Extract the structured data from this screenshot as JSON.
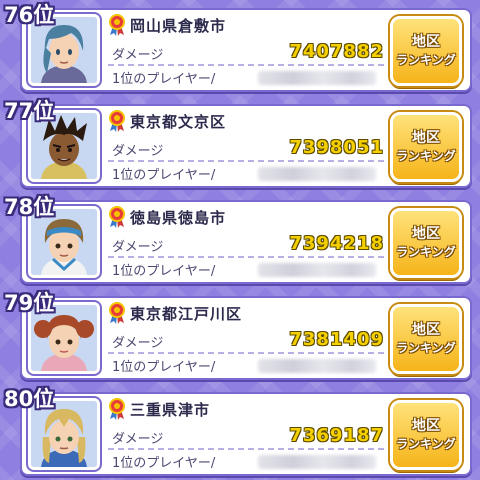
{
  "labels": {
    "damage": "ダメージ",
    "top_player": "1位のプレイヤー/",
    "button_line1": "地区",
    "button_line2": "ランキング"
  },
  "entries": [
    {
      "rank": "76位",
      "location": "岡山県倉敷市",
      "damage": "7407882",
      "avatar": "blue-haired-boy-icon"
    },
    {
      "rank": "77位",
      "location": "東京都文京区",
      "damage": "7398051",
      "avatar": "dark-spiky-hair-boy-icon"
    },
    {
      "rank": "78位",
      "location": "徳島県徳島市",
      "damage": "7394218",
      "avatar": "headband-boy-icon"
    },
    {
      "rank": "79位",
      "location": "東京都江戸川区",
      "damage": "7381409",
      "avatar": "pigtail-girl-icon"
    },
    {
      "rank": "80位",
      "location": "三重県津市",
      "damage": "7369187",
      "avatar": "blonde-boy-icon"
    }
  ],
  "colors": {
    "background": "#8f7fe0",
    "damage_value": "#f5d000",
    "button": "#f5b41a"
  }
}
